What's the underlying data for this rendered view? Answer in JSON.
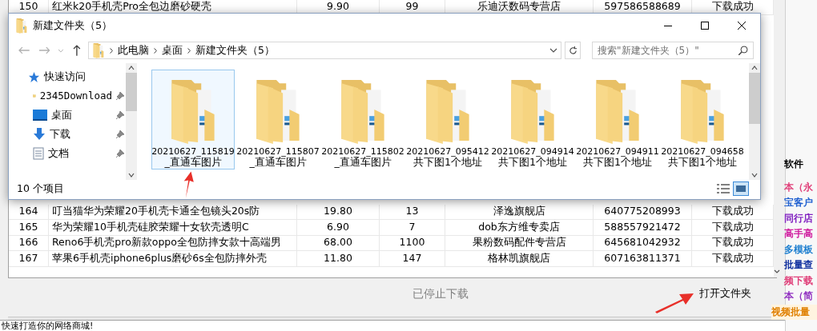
{
  "table": {
    "rows": [
      {
        "index": "150",
        "name": "红米k20手机壳Pro全包边磨砂硬壳",
        "price": "9.90",
        "qty": "99",
        "shop": "乐迪沃数码专营店",
        "id": "597586588689",
        "status": "下载成功"
      },
      {
        "index": "164",
        "name": "叮当猫华为荣耀20手机壳卡通全包镜头20s防",
        "price": "19.80",
        "qty": "13",
        "shop": "泽逸旗舰店",
        "id": "640775208993",
        "status": "下载成功"
      },
      {
        "index": "165",
        "name": "华为荣耀10手机壳硅胶荣耀十女软壳透明C",
        "price": "6.90",
        "qty": "7",
        "shop": "dob东方维专卖店",
        "id": "588557921472",
        "status": "下载成功"
      },
      {
        "index": "166",
        "name": "Reno6手机壳pro新款oppo全包防摔女款十高端男",
        "price": "68.00",
        "qty": "1100",
        "shop": "果粉数码配件专营店",
        "id": "645681042932",
        "status": "下载成功"
      },
      {
        "index": "167",
        "name": "苹果6手机壳iphone6plus磨砂6s全包防摔外壳",
        "price": "11.80",
        "qty": "147",
        "shop": "格林凯旗舰店",
        "id": "607163811371",
        "status": "下载成功"
      }
    ]
  },
  "explorer": {
    "title": "新建文件夹（5）",
    "path": [
      "此电脑",
      "桌面",
      "新建文件夹（5）"
    ],
    "search": {
      "placeholder": "搜索\"新建文件夹（5）\""
    },
    "sidebar": [
      {
        "label": "快速访问",
        "kind": "star"
      },
      {
        "label": "2345Download",
        "kind": "folder",
        "pinned": true
      },
      {
        "label": "桌面",
        "kind": "desktop",
        "pinned": true
      },
      {
        "label": "下载",
        "kind": "download",
        "pinned": true
      },
      {
        "label": "文档",
        "kind": "document",
        "pinned": true
      }
    ],
    "files": [
      {
        "name": "20210627_115819",
        "caption": "_直通车图片",
        "selected": true
      },
      {
        "name": "20210627_115807",
        "caption": "_直通车图片",
        "selected": false
      },
      {
        "name": "20210627_115802",
        "caption": "_直通车图片",
        "selected": false
      },
      {
        "name": "20210627_095412",
        "caption": "共下图1个地址",
        "selected": false
      },
      {
        "name": "20210627_094914",
        "caption": "共下图1个地址",
        "selected": false
      },
      {
        "name": "20210627_094911",
        "caption": "共下图1个地址",
        "selected": false
      },
      {
        "name": "20210627_094658",
        "caption": "共下图1个地址",
        "selected": false
      }
    ],
    "status": "10 个项目"
  },
  "download_status": "已停止下载",
  "open_folder_button": "打开文件夹",
  "side_links": [
    {
      "label": "软件",
      "color": "#000000"
    },
    {
      "label": "本（永",
      "color": "#e0407a"
    },
    {
      "label": "宝客户",
      "color": "#2060d0"
    },
    {
      "label": "同行店",
      "color": "#8020c0"
    },
    {
      "label": "高手高",
      "color": "#d020a0"
    },
    {
      "label": "多模板",
      "color": "#2080d0"
    },
    {
      "label": "批量查",
      "color": "#1030a0"
    },
    {
      "label": "频下载",
      "color": "#e0407a"
    },
    {
      "label": "本（简",
      "color": "#9030c0"
    },
    {
      "label": "视频批量",
      "color": "#e08000"
    }
  ],
  "footer": "快速打造你的网络商城!"
}
